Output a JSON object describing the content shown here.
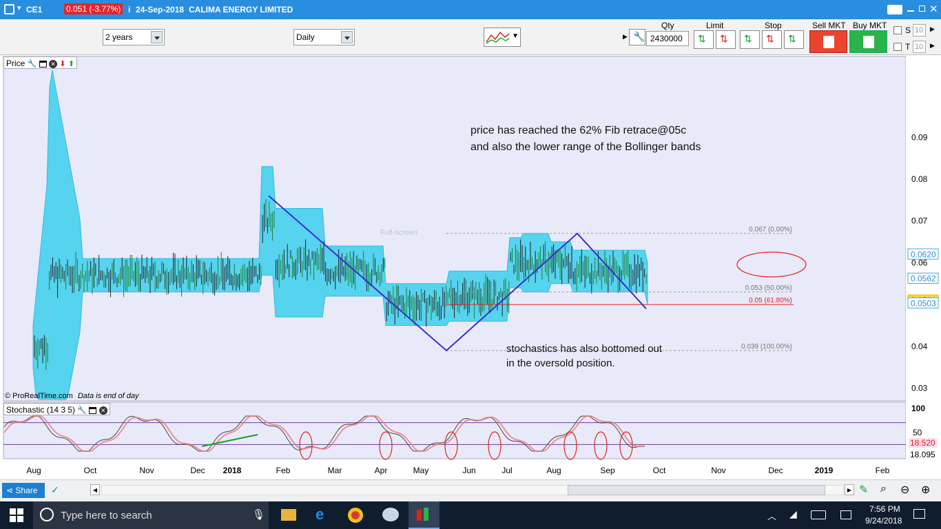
{
  "titlebar": {
    "symbol": "CE1",
    "price_change": "0.051 (-3.77%)",
    "date": "24-Sep-2018",
    "company": "CALIMA ENERGY LIMITED"
  },
  "toolbar": {
    "period": "2 years",
    "interval": "Daily",
    "qty_label": "Qty",
    "qty_value": "2430000",
    "limit_label": "Limit",
    "stop_label": "Stop",
    "sell_label": "Sell MKT",
    "buy_label": "Buy MKT",
    "s_label": "S",
    "t_label": "T",
    "s_value": "10",
    "t_value": "10"
  },
  "chart": {
    "price_panel_label": "Price",
    "copyright": "© ProRealTime.com",
    "eod_note": "Data is end of day",
    "watermark": "Full-screen",
    "annotation1_line1": "price has reached the 62% Fib retrace@05c",
    "annotation1_line2": "and also the lower range of the Bollinger bands",
    "annotation2_line1": "stochastics has also bottomed out",
    "annotation2_line2": "in the oversold position.",
    "fib_levels": [
      {
        "label": "0.067 (0.00%)",
        "value": 0.067
      },
      {
        "label": "0.053 (50.00%)",
        "value": 0.053
      },
      {
        "label": "0.05 (61.80%)",
        "value": 0.05
      },
      {
        "label": "0.039 (100.00%)",
        "value": 0.039
      }
    ],
    "price_ticks": [
      "0.09",
      "0.08",
      "0.07",
      "0.06",
      "0.05",
      "0.04",
      "0.03"
    ],
    "price_tick_values": [
      0.09,
      0.08,
      0.07,
      0.06,
      0.05,
      0.04,
      0.03
    ],
    "price_tags": [
      {
        "label": "0.0620",
        "value": 0.062,
        "color": "#3fa9e0"
      },
      {
        "label": "0.0562",
        "value": 0.0562,
        "color": "#3fa9e0"
      },
      {
        "label": "0.051",
        "value": 0.051,
        "color": "#e6c200"
      },
      {
        "label": "0.0503",
        "value": 0.0503,
        "color": "#3fa9e0"
      }
    ],
    "stoch_label": "Stochastic (14 3 5)",
    "stoch_ticks": [
      "100",
      "50"
    ],
    "stoch_tags": [
      "18.520",
      "18.095"
    ],
    "months": [
      "Aug",
      "Oct",
      "Nov",
      "Dec",
      "2018",
      "Feb",
      "Mar",
      "Apr",
      "May",
      "Jun",
      "Jul",
      "Aug",
      "Sep",
      "Oct",
      "Nov",
      "Dec",
      "2019",
      "Feb"
    ],
    "colors": {
      "band": "#4fd2ef",
      "band_edge": "#29b7de",
      "zigzag": "#3a2fd0",
      "circle": "#e0211c",
      "bg": "#e9eaf9",
      "green_line": "#1c9a2a"
    }
  },
  "chart_data": {
    "type": "line",
    "title": "CE1 24-Sep-2018 CALIMA ENERGY LIMITED",
    "ylim": [
      0.02,
      0.1
    ],
    "zigzag": {
      "x": [
        "2018-01",
        "2018-05",
        "2018-08",
        "2018-09"
      ],
      "y": [
        0.076,
        0.039,
        0.067,
        0.049
      ]
    },
    "fib_retracement": [
      0.067,
      0.053,
      0.05,
      0.039
    ],
    "last_price": 0.051,
    "change_pct": -3.77,
    "stochastic": {
      "name": "Stochastic (14 3 5)",
      "k": 18.52,
      "d": 18.095,
      "ylim": [
        0,
        100
      ]
    }
  },
  "scrollbar": {
    "share_label": "Share"
  },
  "taskbar": {
    "search_placeholder": "Type here to search",
    "time": "7:56 PM",
    "date": "9/24/2018"
  }
}
